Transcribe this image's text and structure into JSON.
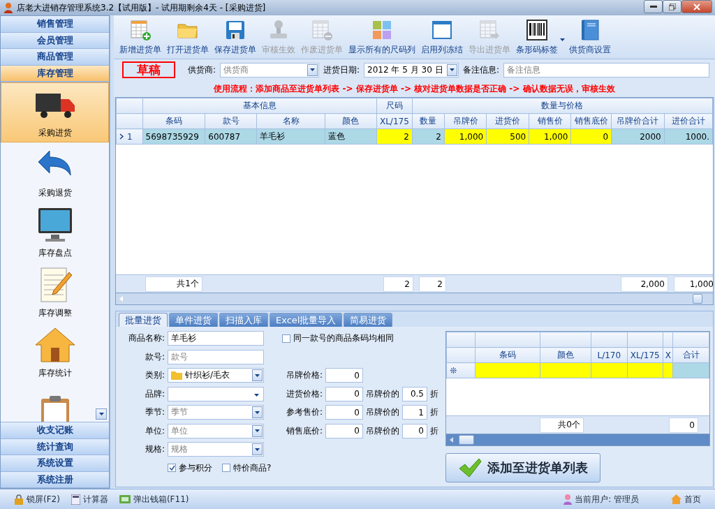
{
  "window": {
    "title": "店老大进销存管理系统3.2【试用版】- 试用期剩余4天 - [采购进货]"
  },
  "sidebar": {
    "top_groups": [
      {
        "label": "销售管理",
        "selected": false
      },
      {
        "label": "会员管理",
        "selected": false
      },
      {
        "label": "商品管理",
        "selected": false
      },
      {
        "label": "库存管理",
        "selected": true
      }
    ],
    "items": [
      {
        "label": "采购进货",
        "selected": true
      },
      {
        "label": "采购退货",
        "selected": false
      },
      {
        "label": "库存盘点",
        "selected": false
      },
      {
        "label": "库存调整",
        "selected": false
      },
      {
        "label": "库存统计",
        "selected": false
      },
      {
        "selected": false
      }
    ],
    "bottom_groups": [
      {
        "label": "收支记账",
        "selected": false
      },
      {
        "label": "统计查询",
        "selected": false
      },
      {
        "label": "系统设置",
        "selected": false
      },
      {
        "label": "系统注册",
        "selected": false
      }
    ]
  },
  "toolbar": [
    {
      "label": "新增进货单",
      "disabled": false,
      "has_menu": false
    },
    {
      "label": "打开进货单",
      "disabled": false,
      "has_menu": false
    },
    {
      "label": "保存进货单",
      "disabled": false,
      "has_menu": false
    },
    {
      "label": "审核生效",
      "disabled": true,
      "has_menu": false
    },
    {
      "label": "作废进货单",
      "disabled": true,
      "has_menu": false
    },
    {
      "label": "显示所有的尺码列",
      "disabled": false,
      "has_menu": false
    },
    {
      "label": "启用列冻结",
      "disabled": false,
      "has_menu": false
    },
    {
      "label": "导出进货单",
      "disabled": true,
      "has_menu": false
    },
    {
      "label": "条形码标签",
      "disabled": false,
      "has_menu": true
    },
    {
      "label": "供货商设置",
      "disabled": false,
      "has_menu": false
    }
  ],
  "order": {
    "status": "草稿",
    "supplier": {
      "label": "供货商:",
      "placeholder": "供货商"
    },
    "date": {
      "label": "进货日期:",
      "value": "2012 年 5 月 30 日"
    },
    "note": {
      "label": "备注信息:",
      "placeholder": "备注信息"
    }
  },
  "instruction": "使用流程：添加商品至进货单列表 -> 保存进货单 -> 核对进货单数据是否正确 -> 确认数据无误，审核生效",
  "grid": {
    "groups": [
      {
        "label": "基本信息",
        "columns": [
          {
            "label": "条码",
            "editable": false,
            "numeric": false,
            "total": "共1个"
          },
          {
            "label": "款号",
            "editable": false,
            "numeric": false
          },
          {
            "label": "名称",
            "editable": false,
            "numeric": false
          },
          {
            "label": "颜色",
            "editable": false,
            "numeric": false
          }
        ]
      },
      {
        "label": "尺码",
        "columns": [
          {
            "label": "XL/175",
            "editable": true,
            "numeric": true,
            "total": "2"
          }
        ]
      },
      {
        "label": "数量与价格",
        "columns": [
          {
            "label": "数量",
            "editable": false,
            "numeric": true,
            "total": "2"
          },
          {
            "label": "吊牌价",
            "editable": true,
            "numeric": true
          },
          {
            "label": "进货价",
            "editable": true,
            "numeric": true
          },
          {
            "label": "销售价",
            "editable": true,
            "numeric": true
          },
          {
            "label": "销售底价",
            "editable": true,
            "numeric": true
          },
          {
            "label": "吊牌价合计",
            "editable": false,
            "numeric": true,
            "total": "2,000"
          },
          {
            "label": "进价合计",
            "editable": false,
            "numeric": true,
            "total": "1,000"
          }
        ]
      }
    ],
    "rows": [
      {
        "marker": "1",
        "selected": true,
        "cells": [
          "5698735929",
          "600787",
          "羊毛衫",
          "蓝色",
          "2",
          "2",
          "1,000",
          "500",
          "1,000",
          "0",
          "2000",
          "1000."
        ]
      }
    ]
  },
  "entry": {
    "tabs": [
      {
        "label": "批量进货",
        "selected": true
      },
      {
        "label": "单件进货",
        "selected": false
      },
      {
        "label": "扫描入库",
        "selected": false
      },
      {
        "label": "Excel批量导入",
        "selected": false
      },
      {
        "label": "简易进货",
        "selected": false
      }
    ],
    "fields": [
      {
        "label": "商品名称:",
        "kind": "text",
        "value": "羊毛衫"
      },
      {
        "label": "款号:",
        "kind": "text",
        "placeholder": "款号"
      },
      {
        "label": "类别:",
        "kind": "tree",
        "value": "针织衫/毛衣"
      },
      {
        "label": "品牌:",
        "kind": "dropdown"
      },
      {
        "label": "季节:",
        "kind": "combo",
        "placeholder": "季节"
      },
      {
        "label": "单位:",
        "kind": "combo",
        "placeholder": "单位"
      },
      {
        "label": "规格:",
        "kind": "combo",
        "placeholder": "规格"
      }
    ],
    "same_barcode": {
      "label": "同一款号的商品条码均相同",
      "checked": false
    },
    "points": {
      "label": "参与积分",
      "checked": true
    },
    "special": {
      "label": "特价商品?",
      "checked": false
    },
    "prices": [
      {
        "label": "吊牌价格:",
        "value": "0"
      },
      {
        "label": "进货价格:",
        "value": "0",
        "ratio_label": "吊牌价的",
        "ratio": "0.5",
        "unit": "折"
      },
      {
        "label": "参考售价:",
        "value": "0",
        "ratio_label": "吊牌价的",
        "ratio": "1",
        "unit": "折"
      },
      {
        "label": "销售底价:",
        "value": "0",
        "ratio_label": "吊牌价的",
        "ratio": "0",
        "unit": "折"
      }
    ]
  },
  "size_grid": {
    "new_row_marker": "❊",
    "columns": [
      {
        "label": "条码",
        "editable": true
      },
      {
        "label": "颜色",
        "editable": true,
        "total": "共0个"
      },
      {
        "label": "L/170",
        "editable": true
      },
      {
        "label": "XL/175",
        "editable": true
      },
      {
        "label": "X",
        "editable": true
      },
      {
        "label": "合计",
        "editable": false,
        "total": "0"
      }
    ]
  },
  "add_button": "添加至进货单列表",
  "status_bar": {
    "tools": [
      {
        "label": "锁屏(F2)"
      },
      {
        "label": "计算器"
      },
      {
        "label": "弹出钱箱(F11)"
      }
    ],
    "user": "当前用户: 管理员",
    "home": "首页"
  }
}
